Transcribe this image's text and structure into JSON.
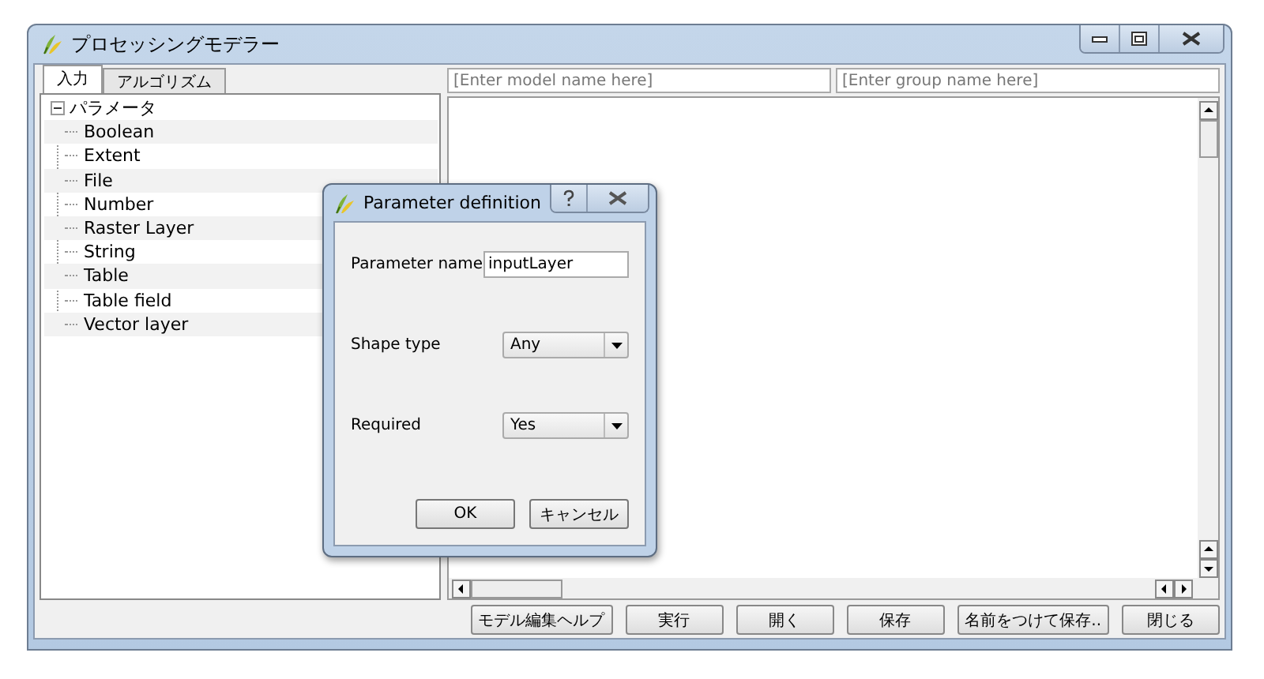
{
  "window": {
    "title": "プロセッシングモデラー"
  },
  "tabs": [
    {
      "label": "入力",
      "selected": true
    },
    {
      "label": "アルゴリズム",
      "selected": false
    }
  ],
  "tree": [
    {
      "label": "パラメータ",
      "expanded": true,
      "children": [
        {
          "label": "Boolean"
        },
        {
          "label": "Extent"
        },
        {
          "label": "File"
        },
        {
          "label": "Number"
        },
        {
          "label": "Raster Layer"
        },
        {
          "label": "String"
        },
        {
          "label": "Table"
        },
        {
          "label": "Table field"
        },
        {
          "label": "Vector layer"
        }
      ]
    }
  ],
  "model_name": {
    "placeholder": "[Enter model name here]"
  },
  "group_name": {
    "placeholder": "[Enter group name here]"
  },
  "buttons": [
    "モデル編集ヘルプ",
    "実行",
    "開く",
    "保存",
    "名前をつけて保存..",
    "閉じる"
  ],
  "dialog": {
    "title": "Parameter definition",
    "fields": [
      {
        "kind": "text",
        "label": "Parameter name",
        "value": "inputLayer"
      },
      {
        "kind": "select",
        "label": "Shape type",
        "value": "Any"
      },
      {
        "kind": "select",
        "label": "Required",
        "value": "Yes"
      }
    ],
    "buttons": [
      "OK",
      "キャンセル"
    ]
  }
}
